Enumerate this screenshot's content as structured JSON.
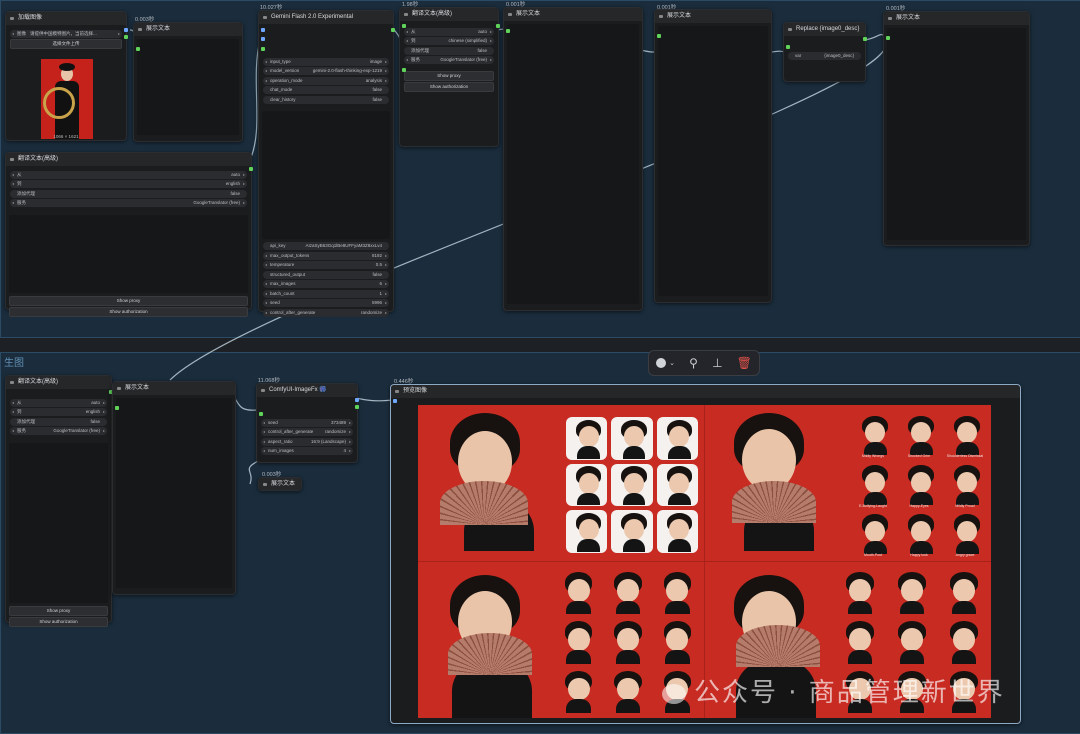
{
  "groups": {
    "bottom_title": "生图"
  },
  "nodes": {
    "load_image": {
      "title": "加载图像",
      "row_label": "图像",
      "row_value": "请提供中国模特图片，当前选择...",
      "upload_label": "选择文件上传",
      "dims": "1066 × 1621"
    },
    "show_text_1": {
      "timing": "0.003秒",
      "title": "展示文本"
    },
    "translate_1": {
      "title": "翻译文本(高级)",
      "rows": [
        {
          "k": "从",
          "v": "auto"
        },
        {
          "k": "到",
          "v": "english"
        },
        {
          "k": "添加代理",
          "v": "false"
        },
        {
          "k": "服务",
          "v": "GoogleTranslator (free)"
        }
      ],
      "show_proxy": "Show proxy",
      "show_auth": "Show authorization"
    },
    "gemini": {
      "timing": "10.027秒",
      "title": "Gemini Flash 2.0 Experimental",
      "rows": [
        {
          "k": "input_type",
          "v": "image"
        },
        {
          "k": "model_version",
          "v": "gemini-2.0-flash-thinking-exp-1219"
        },
        {
          "k": "operation_mode",
          "v": "analysis"
        },
        {
          "k": "chat_mode",
          "v": "false"
        },
        {
          "k": "clear_history",
          "v": "false"
        }
      ],
      "rows2": [
        {
          "k": "api_key",
          "v": "AIzaSyB63Gq1lBe8UFFyaM3Z8xxLv4"
        },
        {
          "k": "max_output_tokens",
          "v": "8192"
        },
        {
          "k": "temperature",
          "v": "0.5"
        },
        {
          "k": "structured_output",
          "v": "false"
        },
        {
          "k": "max_images",
          "v": "6"
        },
        {
          "k": "batch_count",
          "v": "1"
        },
        {
          "k": "seed",
          "v": "5996"
        },
        {
          "k": "control_after_generate",
          "v": "randomize"
        }
      ]
    },
    "translate_2": {
      "timing": "1.98秒",
      "title": "翻译文本(高级)",
      "rows": [
        {
          "k": "从",
          "v": "auto"
        },
        {
          "k": "到",
          "v": "chinese (simplified)"
        },
        {
          "k": "添加代理",
          "v": "false"
        },
        {
          "k": "服务",
          "v": "GoogleTranslator (free)"
        }
      ],
      "show_proxy": "Show proxy",
      "show_auth": "Show authorization"
    },
    "show_text_2": {
      "timing": "0.001秒",
      "title": "展示文本"
    },
    "show_text_3": {
      "timing": "0.001秒",
      "title": "展示文本"
    },
    "replace": {
      "title": "Replace {image0_desc}",
      "row_k": "var",
      "row_v": "{image0_desc}"
    },
    "show_text_4": {
      "timing": "0.001秒",
      "title": "展示文本"
    },
    "translate_3": {
      "title": "翻译文本(高级)",
      "rows": [
        {
          "k": "从",
          "v": "auto"
        },
        {
          "k": "到",
          "v": "english"
        },
        {
          "k": "添加代理",
          "v": "false"
        },
        {
          "k": "服务",
          "v": "GoogleTranslator (free)"
        }
      ],
      "show_proxy": "Show proxy",
      "show_auth": "Show authorization"
    },
    "show_text_5": {
      "title": "展示文本"
    },
    "imagefx": {
      "timing": "11.068秒",
      "title": "ComfyUI-ImageFx 🎆",
      "rows": [
        {
          "k": "seed",
          "v": "373489"
        },
        {
          "k": "control_after_generate",
          "v": "randomize"
        },
        {
          "k": "aspect_ratio",
          "v": "16:9 (Landscape)"
        },
        {
          "k": "num_images",
          "v": "4"
        }
      ]
    },
    "show_text_6": {
      "timing": "0.003秒",
      "title": "展示文本"
    },
    "preview": {
      "timing": "0.446秒",
      "title": "预览图像"
    }
  },
  "sticker_labels": [
    "Mildly Wrongs",
    "Shocked Grim",
    "Shoulderless Dismissal",
    "E-Bullying-Laught",
    "Happy-Eyes",
    "Mildly Proud",
    "Mouth-Pout",
    "Happy look",
    "Angry grace"
  ],
  "watermark": "公众号 · 商品管理新世界",
  "colors": {
    "canvas_red": "#c72b22",
    "accent_blue": "#6fa7ff",
    "link_green": "#5fd35a"
  }
}
